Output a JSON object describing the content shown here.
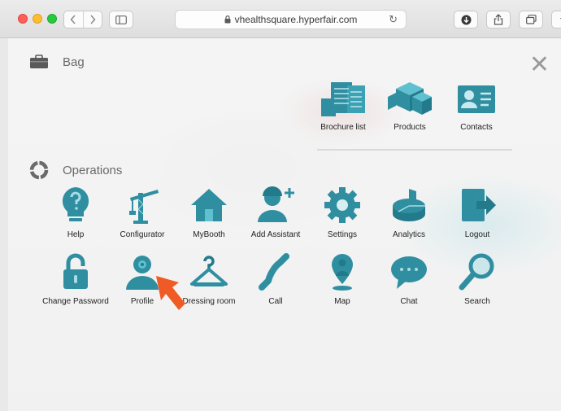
{
  "browser": {
    "url": "vhealthsquare.hyperfair.com",
    "new_tab": "+"
  },
  "bag": {
    "title": "Bag",
    "close": "✕",
    "items": [
      {
        "label": "Brochure list",
        "icon": "brochure-icon"
      },
      {
        "label": "Products",
        "icon": "cubes-icon"
      },
      {
        "label": "Contacts",
        "icon": "contact-card-icon"
      }
    ]
  },
  "operations": {
    "title": "Operations",
    "items": [
      {
        "label": "Help",
        "icon": "help-bulb-icon"
      },
      {
        "label": "Configurator",
        "icon": "crane-icon"
      },
      {
        "label": "MyBooth",
        "icon": "house-icon"
      },
      {
        "label": "Add Assistant",
        "icon": "add-user-icon"
      },
      {
        "label": "Settings",
        "icon": "gear-icon"
      },
      {
        "label": "Analytics",
        "icon": "pie-chart-icon"
      },
      {
        "label": "Logout",
        "icon": "logout-icon"
      },
      {
        "label": "Change Password",
        "icon": "unlock-icon"
      },
      {
        "label": "Profile",
        "icon": "profile-icon"
      },
      {
        "label": "Dressing room",
        "icon": "hanger-icon"
      },
      {
        "label": "Call",
        "icon": "phone-icon"
      },
      {
        "label": "Map",
        "icon": "map-pin-icon"
      },
      {
        "label": "Chat",
        "icon": "chat-bubble-icon"
      },
      {
        "label": "Search",
        "icon": "magnifier-icon"
      }
    ]
  },
  "colors": {
    "accent": "#2f8fa1",
    "cursor": "#f05a24"
  }
}
